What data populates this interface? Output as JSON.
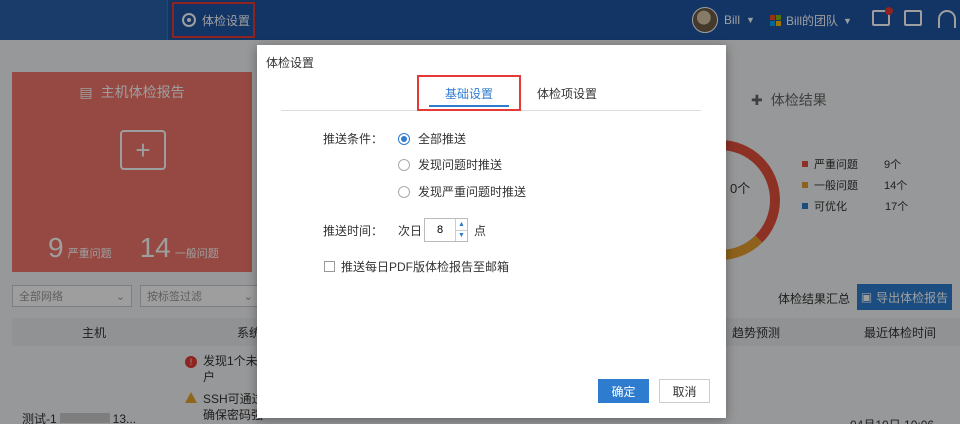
{
  "topbar": {
    "settings_label": "体检设置",
    "user_name": "Bill",
    "team_name": "Bill的团队",
    "icons": [
      "gear-icon",
      "mail-icon",
      "checklist-icon",
      "headset-icon"
    ]
  },
  "background": {
    "host_report_title": "主机体检报告",
    "serious_count": "9",
    "serious_label": "严重问题",
    "general_count": "14",
    "general_label": "一般问题",
    "result_title": "体检结果",
    "legend": [
      {
        "label": "严重问题",
        "count": "9个",
        "color": "#e4503c"
      },
      {
        "label": "一般问题",
        "count": "14个",
        "color": "#e59e2e"
      },
      {
        "label": "可优化",
        "count": "17个",
        "color": "#2d7cd0"
      }
    ],
    "ring_center": "0个",
    "filter_network": "全部网络",
    "filter_tag": "按标签过滤",
    "summary_label": "体检结果汇总",
    "export_label": "导出体检报告",
    "table_headers": [
      "主机",
      "系统",
      "趋势预测",
      "最近体检时间"
    ],
    "row_issue_1a": "发现1个未",
    "row_issue_1b": "户",
    "row_issue_2a": "SSH可通过",
    "row_issue_2b": "确保密码强",
    "row_host": "测试-1",
    "row_host_tail": "13...",
    "row_date": "04月10日 10:06"
  },
  "modal": {
    "title": "体检设置",
    "tabs": [
      "基础设置",
      "体检项设置"
    ],
    "push_condition_label": "推送条件：",
    "push_options": [
      "全部推送",
      "发现问题时推送",
      "发现严重问题时推送"
    ],
    "push_selected": "全部推送",
    "push_time_label": "推送时间：",
    "next_day": "次日",
    "hour_value": "8",
    "hour_unit": "点",
    "pdf_checkbox_label": "推送每日PDF版体检报告至邮箱",
    "confirm_label": "确定",
    "cancel_label": "取消"
  }
}
